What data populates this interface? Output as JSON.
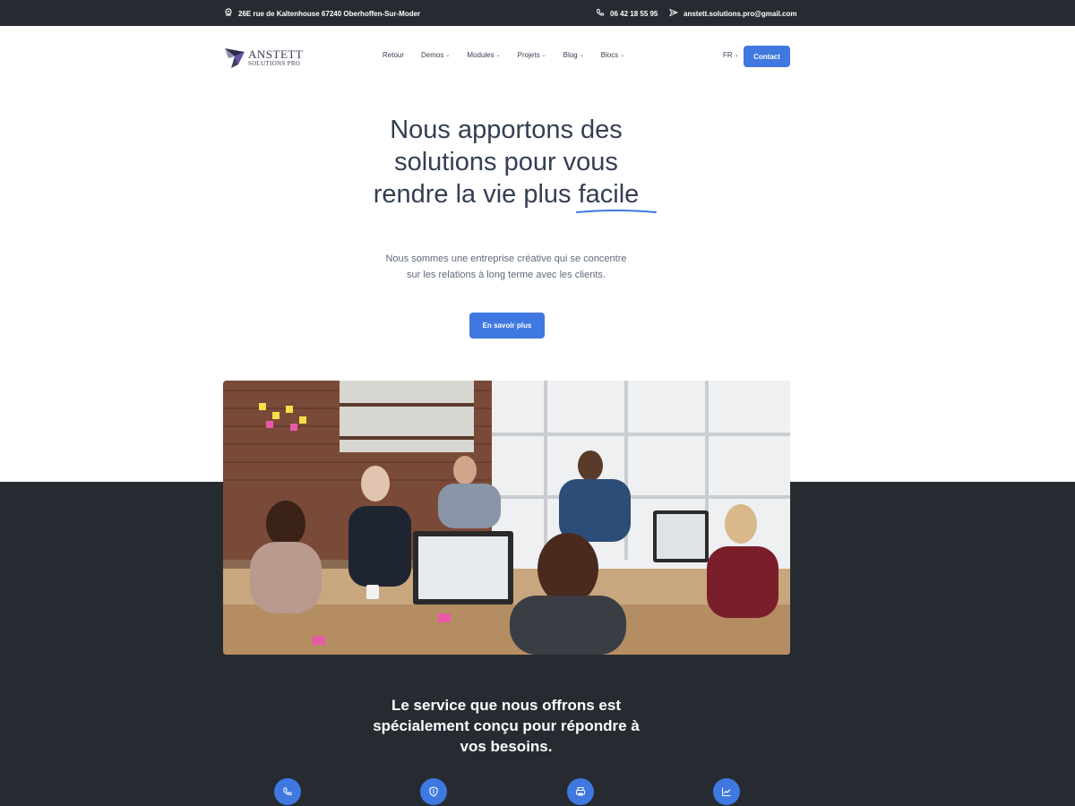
{
  "topbar": {
    "address": "26E rue de Kaltenhouse 67240 Oberhoffen-Sur-Moder",
    "phone": "06 42 18 55 95",
    "email": "anstett.solutions.pro@gmail.com"
  },
  "logo": {
    "line1": "ANSTETT",
    "line2": "SOLUTIONS PRO"
  },
  "nav": {
    "items": [
      {
        "label": "Retour",
        "dropdown": false
      },
      {
        "label": "Demos",
        "dropdown": true
      },
      {
        "label": "Modules",
        "dropdown": true
      },
      {
        "label": "Projets",
        "dropdown": true
      },
      {
        "label": "Blog",
        "dropdown": true
      },
      {
        "label": "Blocs",
        "dropdown": true
      }
    ],
    "language": "FR",
    "contact_label": "Contact"
  },
  "hero": {
    "title_part1": "Nous apportons des solutions pour vous rendre la vie plus",
    "title_highlight": "facile",
    "text": "Nous sommes une entreprise créative qui se concentre sur les relations à long terme avec les clients.",
    "button_label": "En savoir plus"
  },
  "services": {
    "title": "Le service que nous offrons est spécialement conçu pour répondre à vos besoins.",
    "icons": [
      "phone-icon",
      "shield-icon",
      "printer-icon",
      "chart-icon"
    ]
  },
  "colors": {
    "accent": "#3f78e0",
    "dark": "#262b32",
    "text": "#343f52"
  }
}
